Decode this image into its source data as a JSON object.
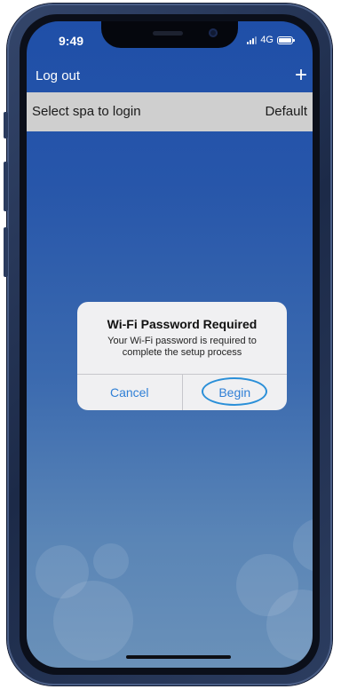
{
  "status_bar": {
    "time": "9:49",
    "network": "4G"
  },
  "nav": {
    "logout_label": "Log out",
    "add_icon": "plus-icon",
    "add_glyph": "+"
  },
  "spa_select": {
    "label": "Select spa to login",
    "value": "Default"
  },
  "dialog": {
    "title": "Wi-Fi Password Required",
    "message": "Your Wi-Fi password is required to complete the setup process",
    "cancel_label": "Cancel",
    "begin_label": "Begin",
    "accent_color": "#2f7fd6",
    "highlight_color": "#2a8fd8"
  },
  "colors": {
    "background_top": "#1f4fa8",
    "background_bottom": "#6a91b9",
    "select_bar": "#cfcfcf"
  }
}
